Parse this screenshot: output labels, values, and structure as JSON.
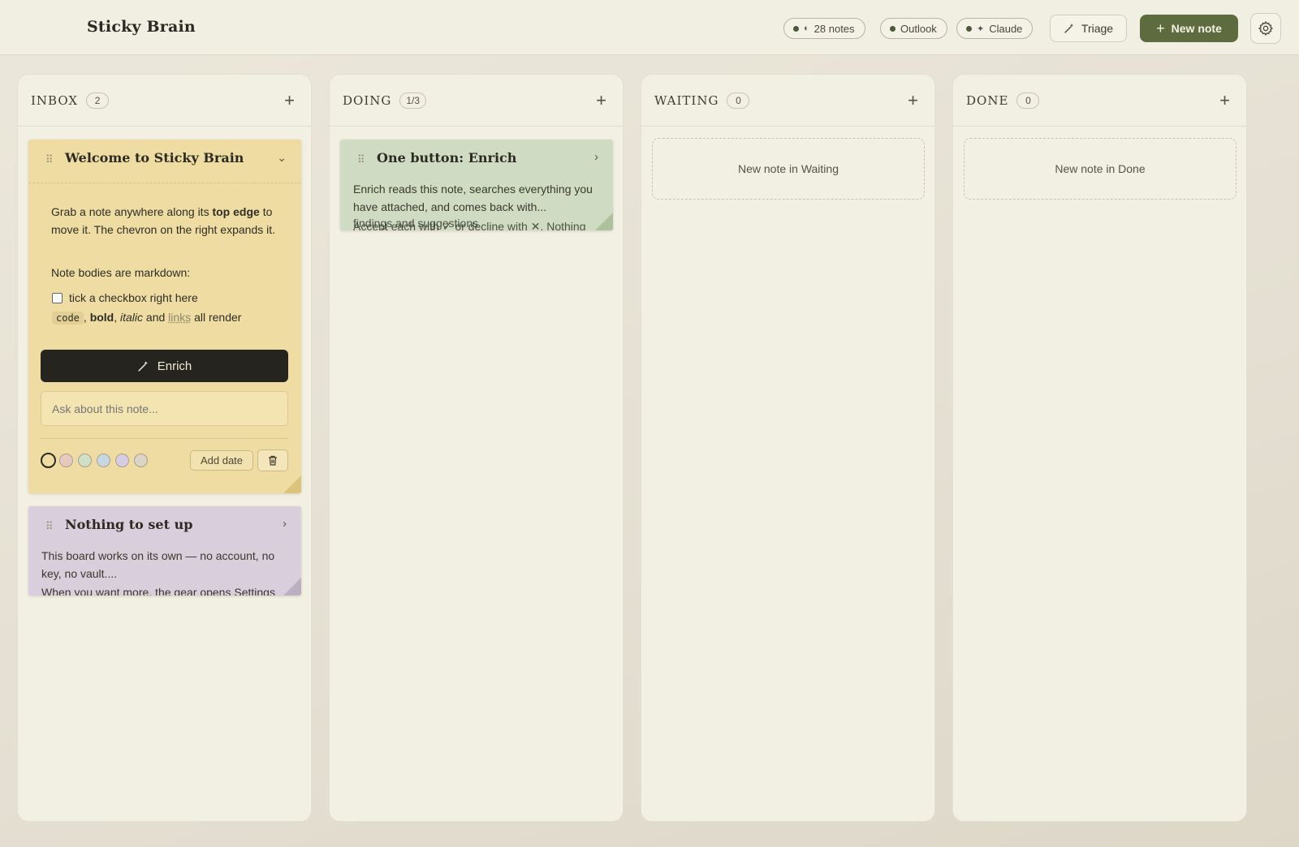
{
  "header": {
    "app_title": "Sticky Brain",
    "notes_pill": "28 notes",
    "outlook_pill": "Outlook",
    "claude_pill": "Claude",
    "triage_label": "Triage",
    "new_note_label": "New note"
  },
  "columns": [
    {
      "title": "INBOX",
      "count": "2"
    },
    {
      "title": "DOING",
      "count": "1/3"
    },
    {
      "title": "WAITING",
      "count": "0"
    },
    {
      "title": "DONE",
      "count": "0"
    }
  ],
  "empty_slots": {
    "waiting": "New note in Waiting",
    "done": "New note in Done"
  },
  "notes": {
    "welcome": {
      "title": "Welcome to Sticky Brain",
      "line1_pre": "Grab a note anywhere along its ",
      "line1_bold": "top edge",
      "line1_post": " to move it. The chevron on the right expands it.",
      "markdown_intro": "Note bodies are markdown:",
      "checkbox_label": "tick a checkbox right here",
      "code": "code",
      "sep1": ", ",
      "bold": "bold",
      "sep2": ", ",
      "italic": "italic",
      "and": " and ",
      "links": "links",
      "all_render": " all render",
      "enrich_label": "Enrich",
      "ask_placeholder": "Ask about this note...",
      "add_date_label": "Add date",
      "color": "#efdca3"
    },
    "nothing": {
      "title": "Nothing to set up",
      "body": "This board works on its own — no account, no key, no vault....",
      "body_cut": "When you want more, the gear opens Settings",
      "color": "#d9cedb"
    },
    "enrich": {
      "title": "One button: Enrich",
      "body": "Enrich reads this note, searches everything you have attached, and comes back with...",
      "body_cut1": "findings and suggestions",
      "body_cut2": "Accept each with ✓ or decline with ✕. Nothing",
      "color": "#cfdcc3"
    }
  },
  "swatch_colors": [
    "#efdca3",
    "#e8c9c0",
    "#cfe0c9",
    "#c7d6e3",
    "#d7cde3",
    "#dcd4c4"
  ],
  "accent_color": "#5d6b3f"
}
